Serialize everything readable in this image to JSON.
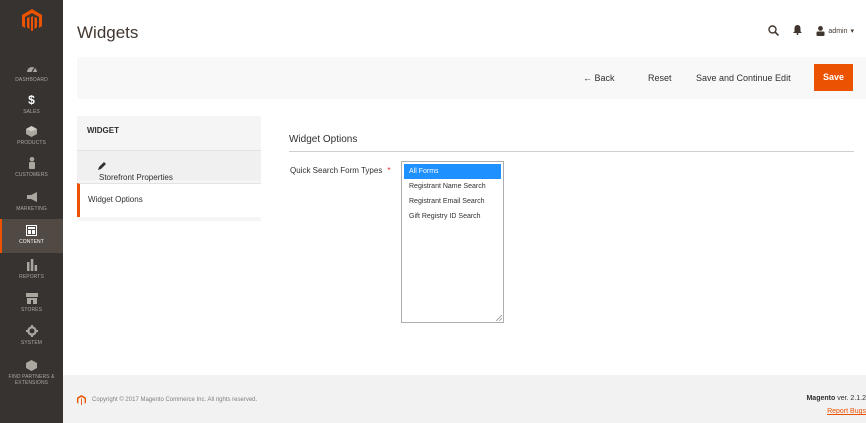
{
  "menu": {
    "items": [
      {
        "label": "Dashboard",
        "icon": "dashboard-icon"
      },
      {
        "label": "Sales",
        "icon": "dollar-icon"
      },
      {
        "label": "Products",
        "icon": "cube-icon"
      },
      {
        "label": "Customers",
        "icon": "person-icon"
      },
      {
        "label": "Marketing",
        "icon": "megaphone-icon"
      },
      {
        "label": "Content",
        "icon": "layout-icon",
        "active": true
      },
      {
        "label": "Reports",
        "icon": "bar-chart-icon"
      },
      {
        "label": "Stores",
        "icon": "store-icon"
      },
      {
        "label": "System",
        "icon": "gear-icon"
      },
      {
        "label": "Find Partners & Extensions",
        "icon": "cube-extension-icon"
      }
    ]
  },
  "header": {
    "title": "Widgets",
    "user": "admin"
  },
  "actions": {
    "back": "Back",
    "reset": "Reset",
    "save_continue": "Save and Continue Edit",
    "save": "Save"
  },
  "tabs": {
    "title": "WIDGET",
    "storefront": "Storefront Properties",
    "options": "Widget Options"
  },
  "fieldset": {
    "title": "Widget Options",
    "field_label": "Quick Search Form Types",
    "required_marker": "*",
    "options": [
      {
        "label": "All Forms",
        "selected": true
      },
      {
        "label": "Registrant Name Search",
        "selected": false
      },
      {
        "label": "Registrant Email Search",
        "selected": false
      },
      {
        "label": "Gift Registry ID Search",
        "selected": false
      }
    ]
  },
  "footer": {
    "copyright": "Copyright © 2017 Magento Commerce Inc. All rights reserved.",
    "brand": "Magento",
    "version": " ver. 2.1.2",
    "report": "Report Bugs"
  },
  "colors": {
    "accent": "#eb5202",
    "menu_bg": "#373330",
    "selected_option": "#1e90ff"
  }
}
